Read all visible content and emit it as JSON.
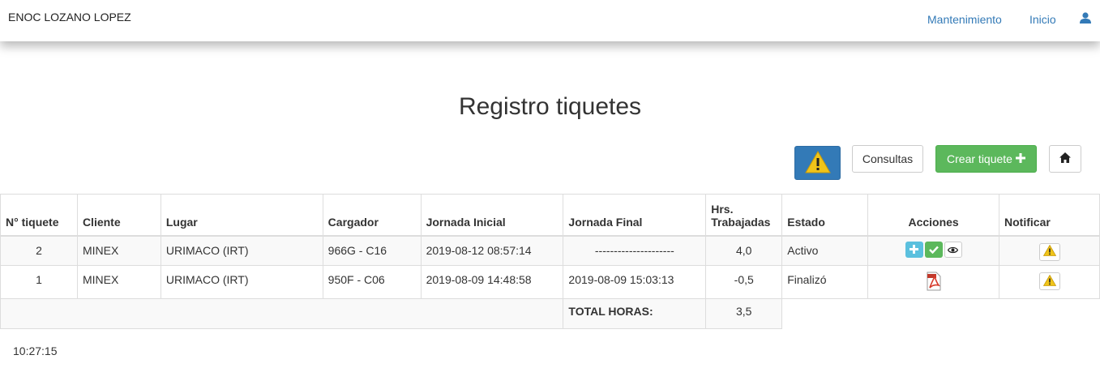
{
  "navbar": {
    "brand": "ENOC LOZANO LOPEZ",
    "links": [
      "Mantenimiento",
      "Inicio"
    ],
    "user_icon": "user-icon"
  },
  "page": {
    "title": "Registro tiquetes"
  },
  "toolbar": {
    "alert_icon": "warning-icon",
    "consultas_label": "Consultas",
    "crear_label": "Crear tiquete",
    "crear_icon": "plus-icon",
    "home_icon": "home-icon"
  },
  "table": {
    "headers": [
      "N° tiquete",
      "Cliente",
      "Lugar",
      "Cargador",
      "Jornada Inicial",
      "Jornada Final",
      "Hrs.\nTrabajadas",
      "Estado",
      "Acciones",
      "Notificar"
    ],
    "rows": [
      {
        "tiquete": "2",
        "cliente": "MINEX",
        "lugar": "URIMACO (IRT)",
        "cargador": "966G - C16",
        "inicial": "2019-08-12 08:57:14",
        "final": "---------------------",
        "horas": "4,0",
        "estado": "Activo",
        "acciones": [
          "plus-icon",
          "check-icon",
          "eye-icon"
        ],
        "notificar": "warning-icon"
      },
      {
        "tiquete": "1",
        "cliente": "MINEX",
        "lugar": "URIMACO (IRT)",
        "cargador": "950F - C06",
        "inicial": "2019-08-09 14:48:58",
        "final": "2019-08-09 15:03:13",
        "horas": "-0,5",
        "estado": "Finalizó",
        "acciones": [
          "pdf-icon"
        ],
        "notificar": "warning-icon"
      }
    ],
    "total_label": "TOTAL HORAS:",
    "total_value": "3,5"
  },
  "clock": "10:27:15",
  "colors": {
    "primary": "#337ab7",
    "success": "#5cb85c",
    "info": "#5bc0de",
    "warning": "#f0c419"
  }
}
